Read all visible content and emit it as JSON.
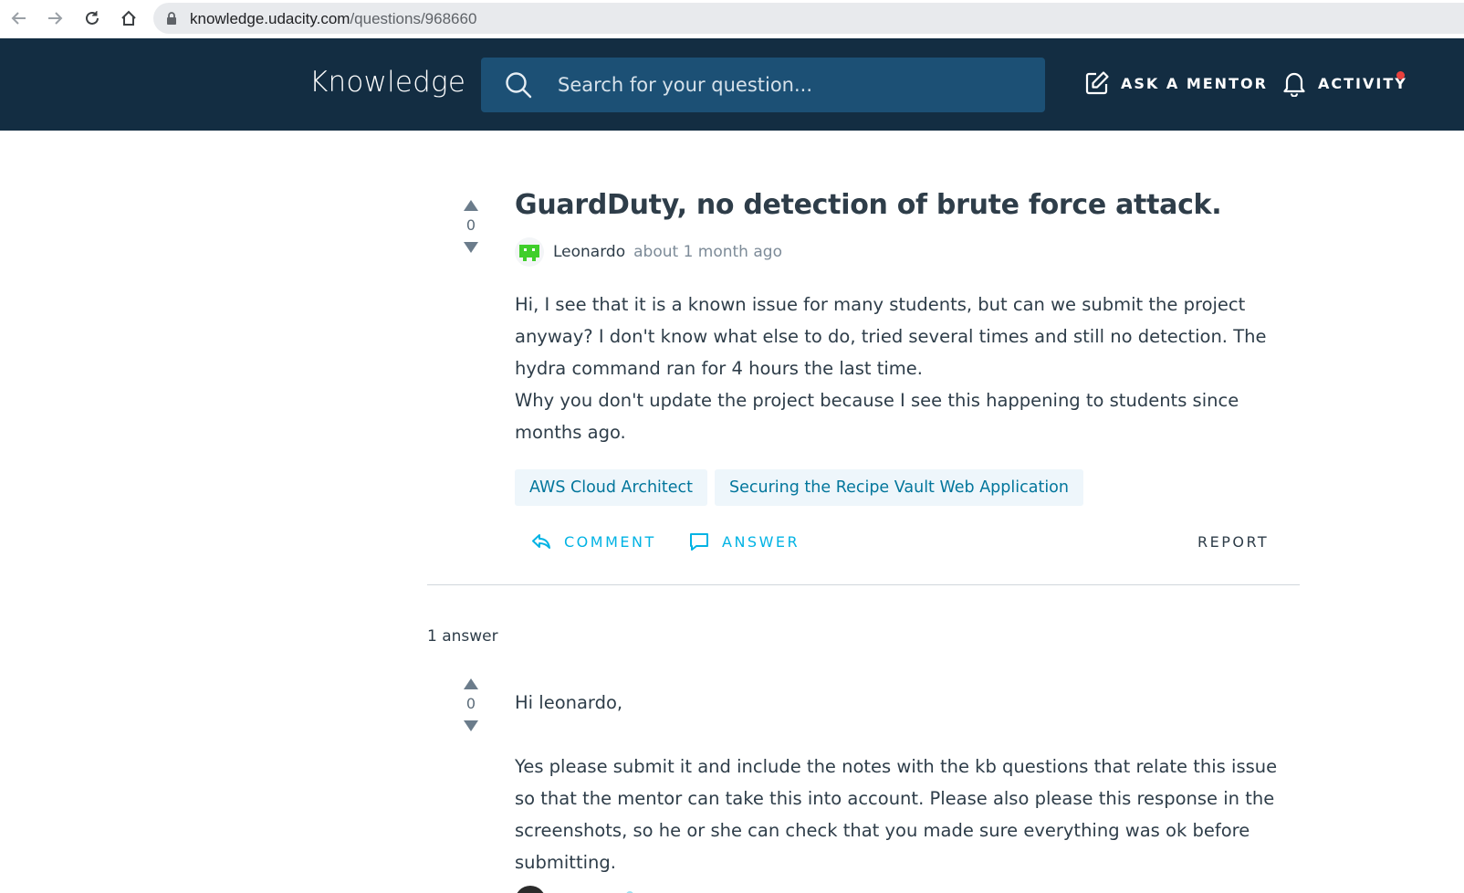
{
  "browser": {
    "url_host": "knowledge.udacity.com",
    "url_path": "/questions/968660"
  },
  "header": {
    "logo": "Knowledge",
    "search_placeholder": "Search for your question...",
    "ask_mentor": "ASK A MENTOR",
    "activity": "ACTIVITY"
  },
  "question": {
    "title": "GuardDuty, no detection of brute force attack.",
    "votes": "0",
    "author": "Leonardo",
    "time": "about 1 month ago",
    "paragraphs": [
      "Hi, I see that it is a known issue for many students, but can we submit the project anyway? I don't know what else to do, tried several times and still no detection. The hydra command ran for 4 hours the last time.",
      "Why you don't update the project because I see this happening to students since months ago."
    ],
    "tags": [
      "AWS Cloud Architect",
      "Securing the Recipe Vault Web Application"
    ],
    "actions": {
      "comment": "COMMENT",
      "answer": "ANSWER",
      "report": "REPORT"
    }
  },
  "answers": {
    "count_label": "1 answer",
    "items": [
      {
        "votes": "0",
        "greeting": "Hi leonardo,",
        "body": "Yes please submit it and include the notes with the kb questions that relate this issue so that the mentor can take this into account. Please also please this response in the screenshots, so he or she can check that you made sure everything was ok before submitting."
      }
    ]
  },
  "colors": {
    "header_bg": "#132d42",
    "search_bg": "#1c5075",
    "accent": "#02b3e4",
    "tag_text": "#02769c",
    "tag_bg": "#eef6fb",
    "notification": "#e8403d"
  }
}
